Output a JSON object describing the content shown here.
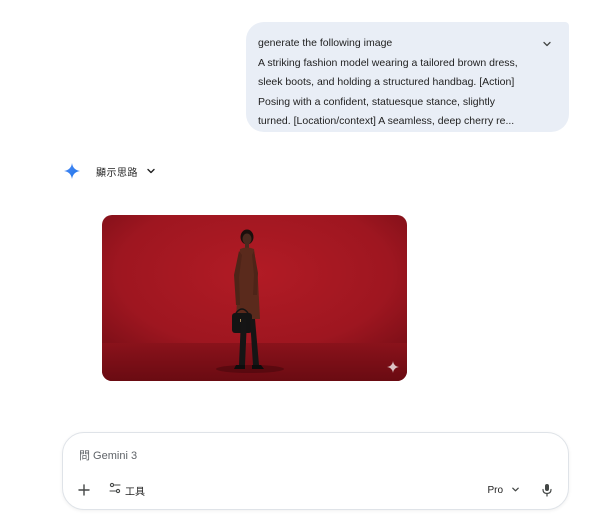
{
  "prompt": {
    "lines": [
      "generate the following image",
      "A striking fashion model wearing a tailored brown dress,",
      "sleek boots, and holding a structured handbag. [Action]",
      "Posing with a confident, statuesque stance, slightly",
      "turned. [Location/context] A seamless, deep cherry re..."
    ],
    "expand_icon": "chevron-down-icon"
  },
  "response": {
    "show_thinking_label": "顯示思路",
    "logo_icon": "gemini-spark-icon",
    "image": {
      "colors": {
        "backdrop": "#9e1620",
        "floor": "#7d0f17",
        "dress": "#5a2a1c",
        "boots": "#151515"
      },
      "watermark_icon": "sparkle-icon"
    }
  },
  "composer": {
    "placeholder": "問 Gemini 3",
    "add_icon": "plus-icon",
    "tools_icon": "tune-icon",
    "tools_label": "工具",
    "model_label": "Pro",
    "model_icon": "chevron-down-icon",
    "mic_icon": "mic-icon"
  }
}
